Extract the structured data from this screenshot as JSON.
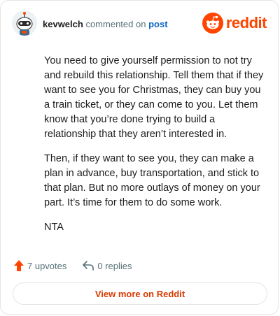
{
  "header": {
    "username": "kevwelch",
    "action_text": "commented on",
    "post_link": "post",
    "brand": "reddit"
  },
  "comment": {
    "paragraphs": [
      "You need to give yourself permission to not try and rebuild this relationship. Tell them that if they want to see you for Christmas, they can buy you a train ticket, or they can come to you. Let them know that you’re done trying to build a relationship that they aren’t interested in.",
      "Then, if they want to see you, they can make a plan in advance, buy transportation, and stick to that plan. But no more outlays of money on your part. It’s time for them to do some work.",
      "NTA"
    ]
  },
  "actions": {
    "upvotes": "7 upvotes",
    "replies": "0 replies"
  },
  "footer": {
    "view_more": "View more on Reddit"
  },
  "colors": {
    "brand": "#ff4500",
    "upvote": "#ff4500",
    "link": "#0a66c2",
    "muted": "#576f76"
  },
  "icons": [
    "avatar-robot-icon",
    "reddit-snoo-icon",
    "upvote-arrow-icon",
    "reply-arrow-icon"
  ]
}
